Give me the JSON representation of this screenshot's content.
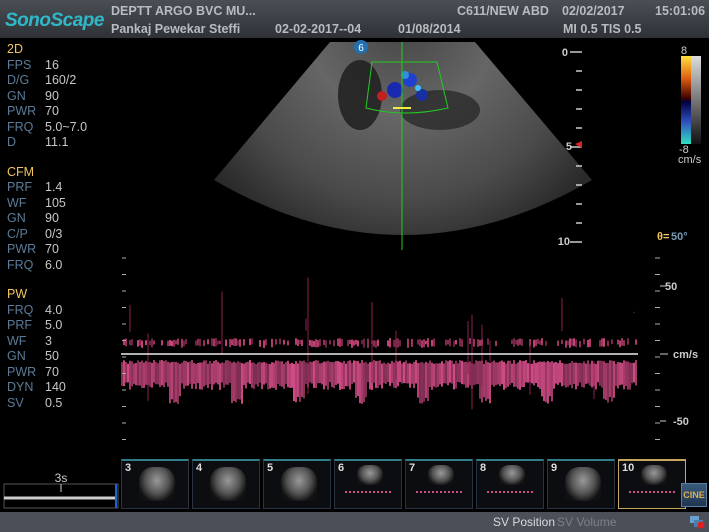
{
  "header": {
    "logo": "SonoScape",
    "patient_dept": "DEPTT ARGO BVC MU...",
    "patient_name": "Pankaj Pewekar Steffi",
    "exam_id": "02-02-2017--04",
    "dob": "01/08/2014",
    "probe_preset": "C611/NEW ABD",
    "date": "02/02/2017",
    "time": "15:01:06",
    "mi_tis": "MI 0.5 TIS 0.5"
  },
  "params": {
    "2d": {
      "title": "2D",
      "rows": [
        {
          "k": "FPS",
          "v": "16"
        },
        {
          "k": "D/G",
          "v": "160/2"
        },
        {
          "k": "GN",
          "v": "90"
        },
        {
          "k": "PWR",
          "v": "70"
        },
        {
          "k": "FRQ",
          "v": "5.0~7.0"
        },
        {
          "k": "D",
          "v": "11.1"
        }
      ]
    },
    "cfm": {
      "title": "CFM",
      "rows": [
        {
          "k": "PRF",
          "v": "1.4"
        },
        {
          "k": "WF",
          "v": "105"
        },
        {
          "k": "GN",
          "v": "90"
        },
        {
          "k": "C/P",
          "v": "0/3"
        },
        {
          "k": "PWR",
          "v": "70"
        },
        {
          "k": "FRQ",
          "v": "6.0"
        }
      ]
    },
    "pw": {
      "title": "PW",
      "rows": [
        {
          "k": "FRQ",
          "v": "4.0"
        },
        {
          "k": "PRF",
          "v": "5.0"
        },
        {
          "k": "WF",
          "v": "3"
        },
        {
          "k": "GN",
          "v": "50"
        },
        {
          "k": "PWR",
          "v": "70"
        },
        {
          "k": "DYN",
          "v": "140"
        },
        {
          "k": "SV",
          "v": "0.5"
        }
      ]
    }
  },
  "depth_scale": {
    "top": "0",
    "mid": "5",
    "bottom": "10"
  },
  "color_bar": {
    "max": "8",
    "min": "-8",
    "unit": "cm/s"
  },
  "angle": {
    "symbol": "θ=",
    "value": "50°"
  },
  "spectrum_scale": {
    "upper": "50",
    "baseline": "cm/s",
    "lower": "-50"
  },
  "focus_marker": "6",
  "time_scale": "3s",
  "thumbnails": [
    {
      "n": "3",
      "type": "2d"
    },
    {
      "n": "4",
      "type": "2d"
    },
    {
      "n": "5",
      "type": "2d"
    },
    {
      "n": "6",
      "type": "doppler"
    },
    {
      "n": "7",
      "type": "doppler"
    },
    {
      "n": "8",
      "type": "doppler"
    },
    {
      "n": "9",
      "type": "2d"
    },
    {
      "n": "10",
      "type": "doppler",
      "selected": true
    }
  ],
  "cine_label": "CINE",
  "footer": {
    "sv_position": "SV Position",
    "sv_volume": "SV Volume"
  },
  "colors": {
    "accent": "#f2c462",
    "logo": "#2fb8c8",
    "doppler": "#d04c86"
  }
}
